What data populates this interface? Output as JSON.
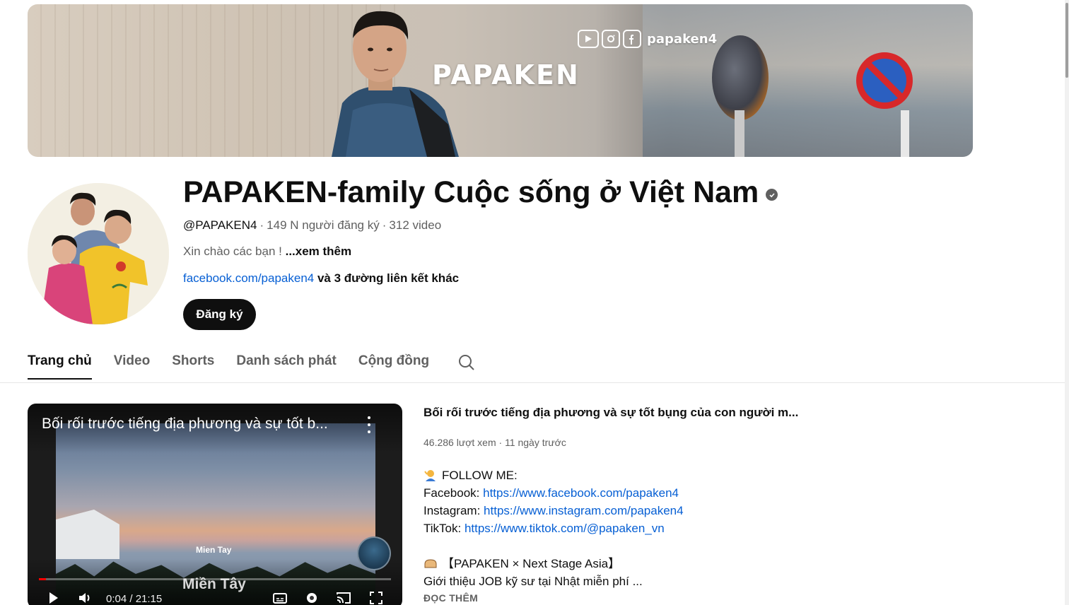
{
  "banner": {
    "brand": "PAPAKEN",
    "social_handle": "papaken4"
  },
  "channel": {
    "name": "PAPAKEN-family Cuộc sống ở Việt Nam",
    "handle": "@PAPAKEN4",
    "subscribers": "149 N người đăng ký",
    "video_count": "312 video",
    "description": "Xin chào các bạn ! ",
    "description_more": "...xem thêm",
    "link": "facebook.com/papaken4",
    "more_links": " và 3 đường liên kết khác",
    "subscribe_label": "Đăng ký"
  },
  "tabs": [
    {
      "label": "Trang chủ",
      "active": true
    },
    {
      "label": "Video",
      "active": false
    },
    {
      "label": "Shorts",
      "active": false
    },
    {
      "label": "Danh sách phát",
      "active": false
    },
    {
      "label": "Cộng đồng",
      "active": false
    }
  ],
  "player": {
    "title": "Bối rối trước tiếng địa phương và sự tốt b...",
    "chapter_overlay": "Mien Tay",
    "chapter_big": "Miền Tây",
    "time": "0:04 / 21:15",
    "progress": 0.003
  },
  "video": {
    "title": "Bối rối trước tiếng địa phương và sự tốt bụng của con người m...",
    "views": "46.286 lượt xem",
    "age": "11 ngày trước",
    "follow_heading": "FOLLOW ME:",
    "facebook_label": "Facebook: ",
    "facebook_url": "https://www.facebook.com/papaken4",
    "instagram_label": "Instagram: ",
    "instagram_url": "https://www.instagram.com/papaken4",
    "tiktok_label": "TikTok: ",
    "tiktok_url": "https://www.tiktok.com/@papaken_vn",
    "promo_heading": "【PAPAKEN × Next Stage Asia】",
    "promo_text": "Giới thiệu JOB kỹ sư tại Nhật miễn phí ...",
    "read_more": "ĐỌC THÊM"
  },
  "colors": {
    "link": "#065fd4",
    "text_primary": "#0f0f0f",
    "text_secondary": "#606060",
    "progress": "#ff0000"
  }
}
